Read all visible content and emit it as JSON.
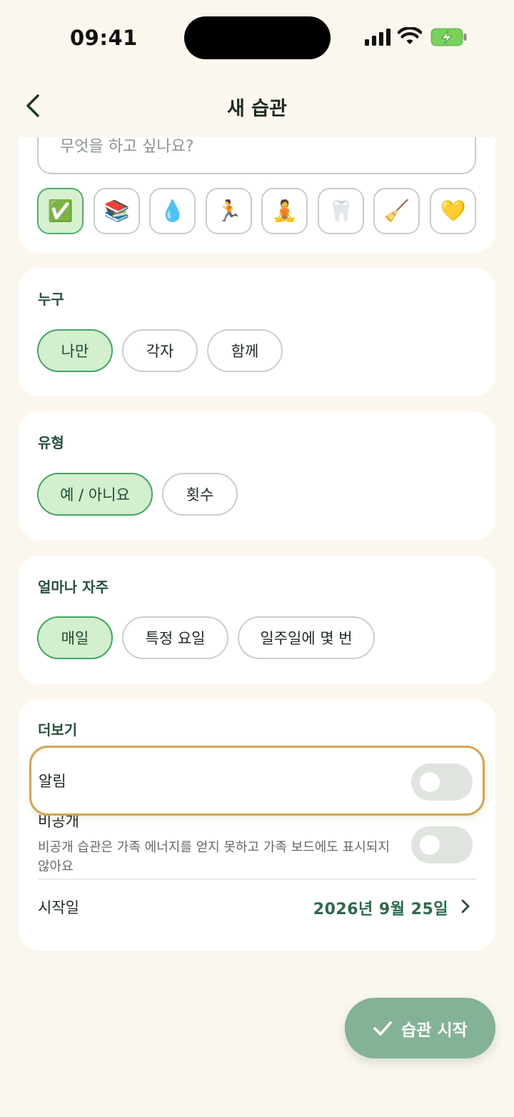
{
  "status": {
    "time": "09:41"
  },
  "nav": {
    "title": "새 습관"
  },
  "name_input": {
    "placeholder": "무엇을 하고 싶나요?"
  },
  "emojis": [
    "✅",
    "📚",
    "💧",
    "🏃",
    "🧘",
    "🦷",
    "🧹",
    "💛"
  ],
  "who": {
    "label": "누구",
    "options": [
      "나만",
      "각자",
      "함께"
    ],
    "selected": 0
  },
  "type": {
    "label": "유형",
    "options": [
      "예 / 아니요",
      "횟수"
    ],
    "selected": 0
  },
  "frequency": {
    "label": "얼마나 자주",
    "options": [
      "매일",
      "특정 요일",
      "일주일에 몇 번"
    ],
    "selected": 0
  },
  "more": {
    "label": "더보기",
    "notification_label": "알림",
    "private_label": "비공개",
    "private_helper": "비공개 습관은 가족 에너지를 얻지 못하고 가족 보드에도 표시되지 않아요",
    "start_label": "시작일",
    "start_value": "2026년 9월 25일"
  },
  "fab": {
    "label": "습관 시작"
  },
  "colors": {
    "accent": "#2b6a4b",
    "selected_fill": "#d4efcd",
    "highlight": "#d8a44b",
    "fab": "#83b297"
  }
}
